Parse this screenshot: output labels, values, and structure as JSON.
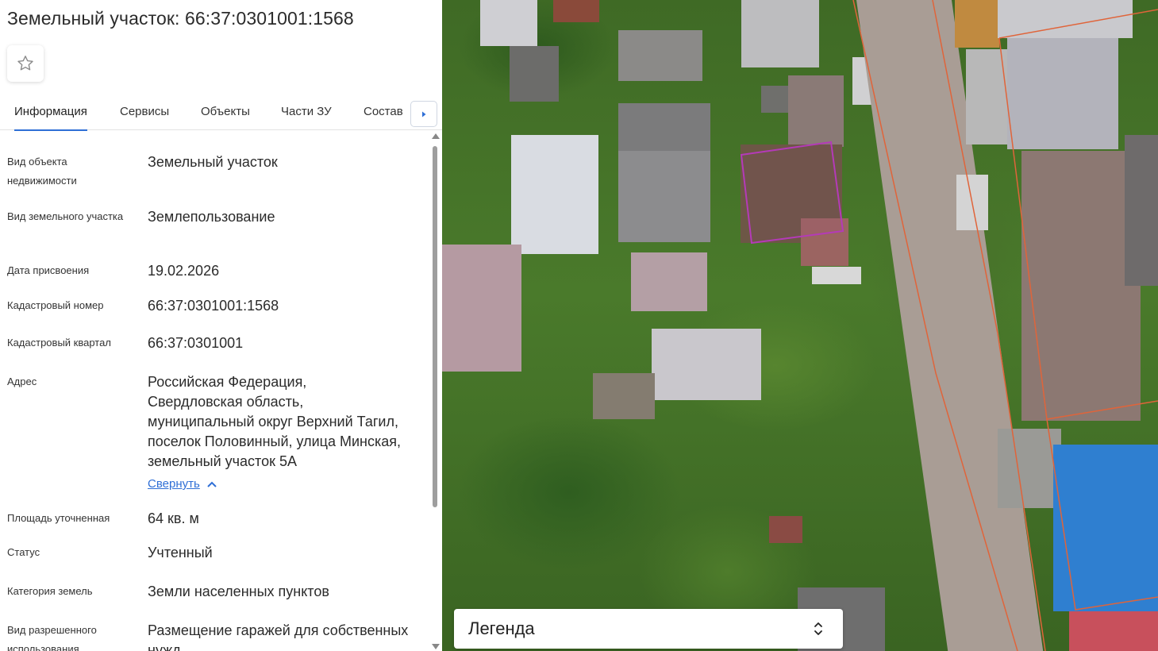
{
  "header": {
    "title": "Земельный участок: 66:37:0301001:1568"
  },
  "icons": {
    "favorite": "star-outline-icon",
    "tabs_next": "caret-right-icon",
    "collapse": "chevron-up-icon",
    "legend_toggle": "chevron-up-down-icon"
  },
  "tabs": [
    {
      "label": "Информация",
      "active": true
    },
    {
      "label": "Сервисы"
    },
    {
      "label": "Объекты"
    },
    {
      "label": "Части ЗУ"
    },
    {
      "label": "Состав"
    }
  ],
  "info": {
    "object_type": {
      "label": "Вид объекта недвижимости",
      "value": "Земельный участок"
    },
    "parcel_type": {
      "label": "Вид земельного участка",
      "value": "Землепользование"
    },
    "assigned_date": {
      "label": "Дата присвоения",
      "value": "19.02.2026"
    },
    "cadastral_number": {
      "label": "Кадастровый номер",
      "value": "66:37:0301001:1568"
    },
    "cadastral_quarter": {
      "label": "Кадастровый квартал",
      "value": "66:37:0301001"
    },
    "address": {
      "label": "Адрес",
      "value": "Российская Федерация, Свердловская область, муниципальный округ Верхний Тагил, поселок Половинный, улица Минская, земельный участок 5А"
    },
    "collapse_link": "Свернуть",
    "area": {
      "label": "Площадь уточненная",
      "value": "64 кв. м"
    },
    "status": {
      "label": "Статус",
      "value": "Учтенный"
    },
    "land_category": {
      "label": "Категория земель",
      "value": "Земли населенных пунктов"
    },
    "permitted_use": {
      "label": "Вид разрешенного использования",
      "value": "Размещение гаражей для собственных нужд"
    }
  },
  "legend": {
    "title": "Легенда"
  },
  "colors": {
    "accent": "#2f6fd6",
    "selected_parcel_outline": "#b43ab8",
    "parcel_boundary": "#e0643a"
  }
}
